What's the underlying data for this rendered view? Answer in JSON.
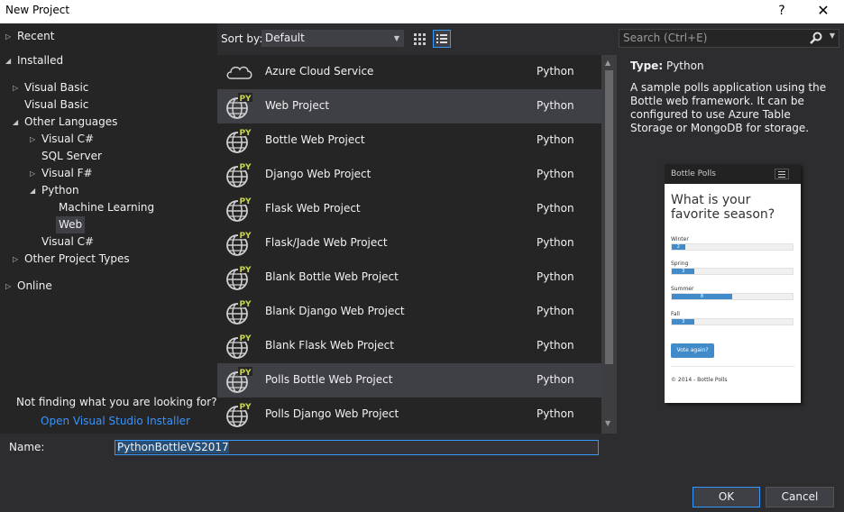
{
  "window": {
    "title": "New Project",
    "help_glyph": "?",
    "close_glyph": "✕"
  },
  "tree": {
    "recent": "Recent",
    "installed": "Installed",
    "visual_basic_group": "Visual Basic",
    "visual_basic": "Visual Basic",
    "other_languages": "Other Languages",
    "visual_csharp": "Visual C#",
    "sql_server": "SQL Server",
    "visual_fsharp": "Visual F#",
    "python": "Python",
    "machine_learning": "Machine Learning",
    "web": "Web",
    "visual_csharp_2": "Visual C#",
    "other_project_types": "Other Project Types",
    "online": "Online"
  },
  "help": {
    "not_finding": "Not finding what you are looking for?",
    "installer_link": "Open Visual Studio Installer"
  },
  "sort": {
    "label": "Sort by:",
    "value": "Default"
  },
  "search": {
    "placeholder": "Search (Ctrl+E)"
  },
  "templates": [
    {
      "name": "Azure Cloud Service",
      "lang": "Python",
      "icon": "cloud-icon"
    },
    {
      "name": "Web Project",
      "lang": "Python",
      "icon": "python-web-icon",
      "selected": true
    },
    {
      "name": "Bottle Web Project",
      "lang": "Python",
      "icon": "python-web-icon"
    },
    {
      "name": "Django Web Project",
      "lang": "Python",
      "icon": "python-web-icon"
    },
    {
      "name": "Flask Web Project",
      "lang": "Python",
      "icon": "python-web-icon"
    },
    {
      "name": "Flask/Jade Web Project",
      "lang": "Python",
      "icon": "python-web-icon"
    },
    {
      "name": "Blank Bottle Web Project",
      "lang": "Python",
      "icon": "python-web-icon"
    },
    {
      "name": "Blank Django Web Project",
      "lang": "Python",
      "icon": "python-web-icon"
    },
    {
      "name": "Blank Flask Web Project",
      "lang": "Python",
      "icon": "python-web-icon"
    },
    {
      "name": "Polls Bottle Web Project",
      "lang": "Python",
      "icon": "python-web-icon",
      "hover": true
    },
    {
      "name": "Polls Django Web Project",
      "lang": "Python",
      "icon": "python-web-icon"
    }
  ],
  "details": {
    "type_label": "Type:",
    "type_value": "Python",
    "description": "A sample polls application using the Bottle web framework. It can be configured to use Azure Table Storage or MongoDB for storage."
  },
  "preview": {
    "brand": "Bottle Polls",
    "question": "What is your favorite season?",
    "options": [
      {
        "label": "Winter",
        "votes": "2",
        "fraction": 0.11
      },
      {
        "label": "Spring",
        "votes": "3",
        "fraction": 0.19
      },
      {
        "label": "Summer",
        "votes": "8",
        "fraction": 0.5
      },
      {
        "label": "Fall",
        "votes": "3",
        "fraction": 0.19
      }
    ],
    "vote_button": "Vote again?",
    "footer": "© 2014 - Bottle Polls"
  },
  "name_field": {
    "label": "Name:",
    "value": "PythonBottleVS2017"
  },
  "buttons": {
    "ok": "OK",
    "cancel": "Cancel"
  },
  "colors": {
    "accent": "#3399ff",
    "link": "#3794ff",
    "python_badge": "#cbd64f"
  }
}
